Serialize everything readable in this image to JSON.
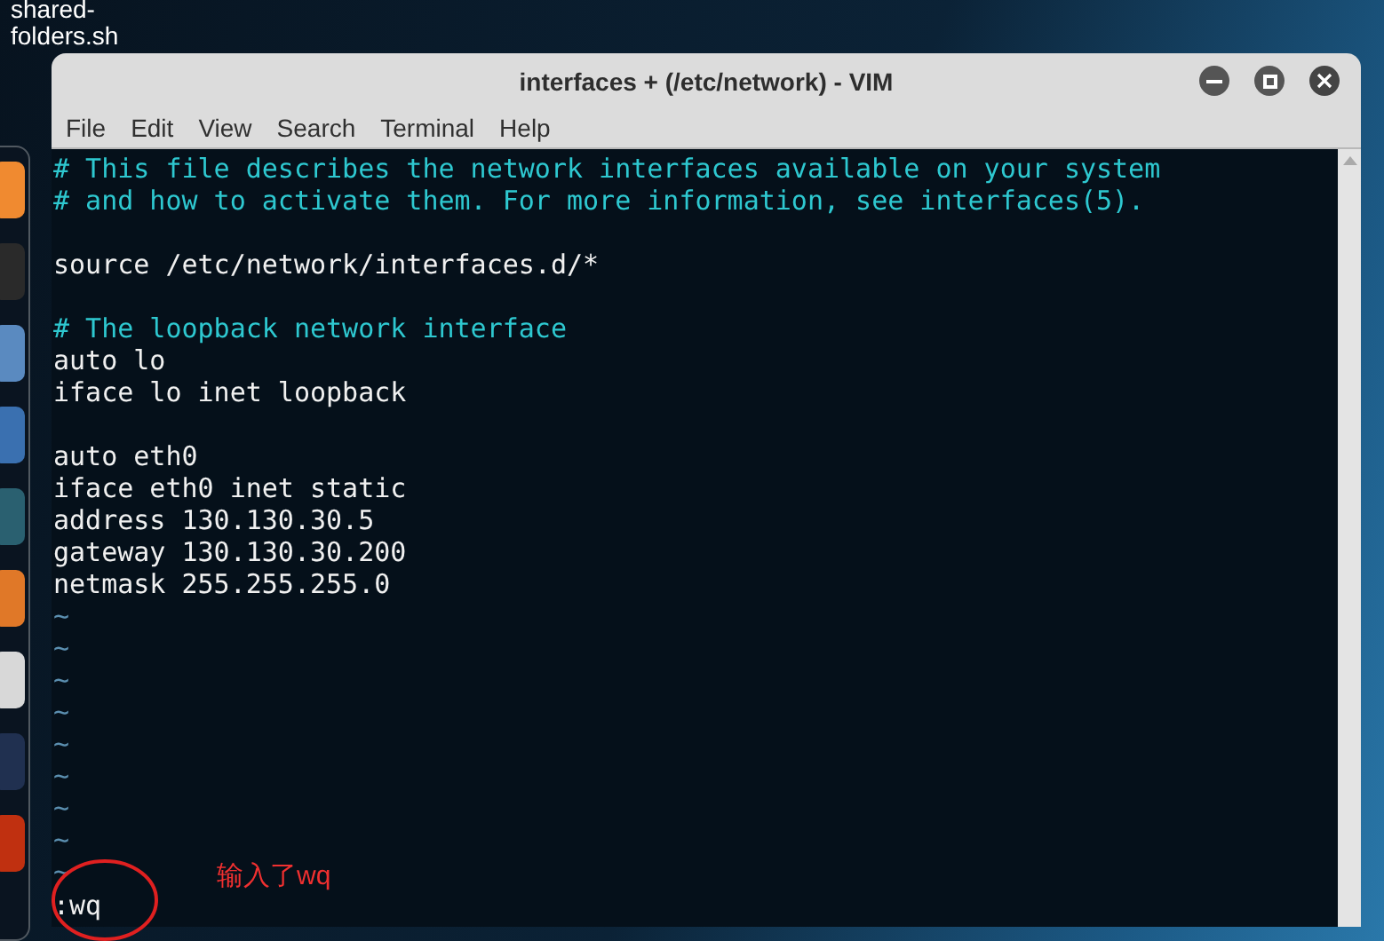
{
  "desktop_icon": {
    "label": "shared-\nfolders.sh"
  },
  "window": {
    "title": "interfaces + (/etc/network) - VIM"
  },
  "menu": [
    "File",
    "Edit",
    "View",
    "Search",
    "Terminal",
    "Help"
  ],
  "lines": [
    {
      "kind": "comment",
      "text": "# This file describes the network interfaces available on your system"
    },
    {
      "kind": "comment",
      "text": "# and how to activate them. For more information, see interfaces(5)."
    },
    {
      "kind": "blank"
    },
    {
      "kind": "text",
      "text": "source /etc/network/interfaces.d/*"
    },
    {
      "kind": "blank"
    },
    {
      "kind": "comment",
      "text": "# The loopback network interface"
    },
    {
      "kind": "text",
      "text": "auto lo"
    },
    {
      "kind": "text",
      "text": "iface lo inet loopback"
    },
    {
      "kind": "blank"
    },
    {
      "kind": "text",
      "text": "auto eth0"
    },
    {
      "kind": "text",
      "text": "iface eth0 inet static"
    },
    {
      "kind": "text",
      "text": "address 130.130.30.5"
    },
    {
      "kind": "text",
      "text": "gateway 130.130.30.200"
    },
    {
      "kind": "text",
      "text": "netmask 255.255.255.0"
    },
    {
      "kind": "tilde",
      "text": "~"
    },
    {
      "kind": "tilde",
      "text": "~"
    },
    {
      "kind": "tilde",
      "text": "~"
    },
    {
      "kind": "tilde",
      "text": "~"
    },
    {
      "kind": "tilde",
      "text": "~"
    },
    {
      "kind": "tilde",
      "text": "~"
    },
    {
      "kind": "tilde",
      "text": "~"
    },
    {
      "kind": "tilde",
      "text": "~"
    },
    {
      "kind": "tilde",
      "text": "~"
    }
  ],
  "command_line": ":wq",
  "annotation": {
    "text": "输入了wq"
  }
}
